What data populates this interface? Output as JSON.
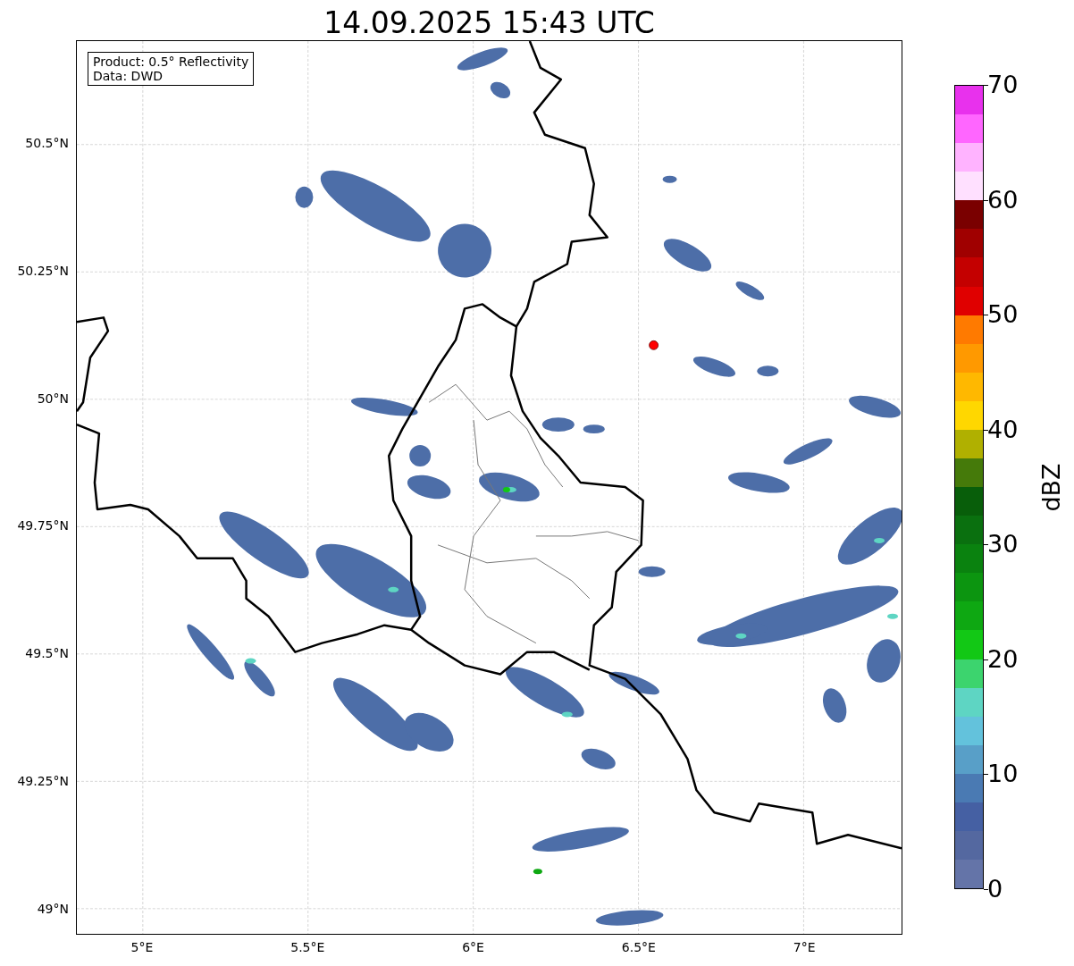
{
  "title": "14.09.2025 15:43 UTC",
  "legend": [
    "Product: 0.5° Reflectivity",
    "Data: DWD"
  ],
  "y_ticks": [
    "50.5°N",
    "50.25°N",
    "50°N",
    "49.75°N",
    "49.5°N",
    "49.25°N",
    "49°N"
  ],
  "x_ticks": [
    "5°E",
    "5.5°E",
    "6°E",
    "6.5°E",
    "7°E"
  ],
  "colorbar": {
    "label": "dBZ",
    "ticks": [
      "70",
      "60",
      "50",
      "40",
      "30",
      "20",
      "10",
      "0"
    ],
    "segments": [
      {
        "color": "#e831ed"
      },
      {
        "color": "#ff66ff"
      },
      {
        "color": "#ffb3ff"
      },
      {
        "color": "#ffe0ff"
      },
      {
        "color": "#7a0000"
      },
      {
        "color": "#a00000"
      },
      {
        "color": "#c40000"
      },
      {
        "color": "#e00000"
      },
      {
        "color": "#ff7a00"
      },
      {
        "color": "#ff9900"
      },
      {
        "color": "#ffb800"
      },
      {
        "color": "#ffd700"
      },
      {
        "color": "#b0b000"
      },
      {
        "color": "#457a0a"
      },
      {
        "color": "#085e0a"
      },
      {
        "color": "#0a700f"
      },
      {
        "color": "#0a820f"
      },
      {
        "color": "#0c9510"
      },
      {
        "color": "#0ea812"
      },
      {
        "color": "#12c815"
      },
      {
        "color": "#3cd46e"
      },
      {
        "color": "#5ed5c3"
      },
      {
        "color": "#63c2dc"
      },
      {
        "color": "#589fc8"
      },
      {
        "color": "#4a7ab3"
      },
      {
        "color": "#4560a3"
      },
      {
        "color": "#5468a0"
      },
      {
        "color": "#6474a8"
      }
    ]
  }
}
